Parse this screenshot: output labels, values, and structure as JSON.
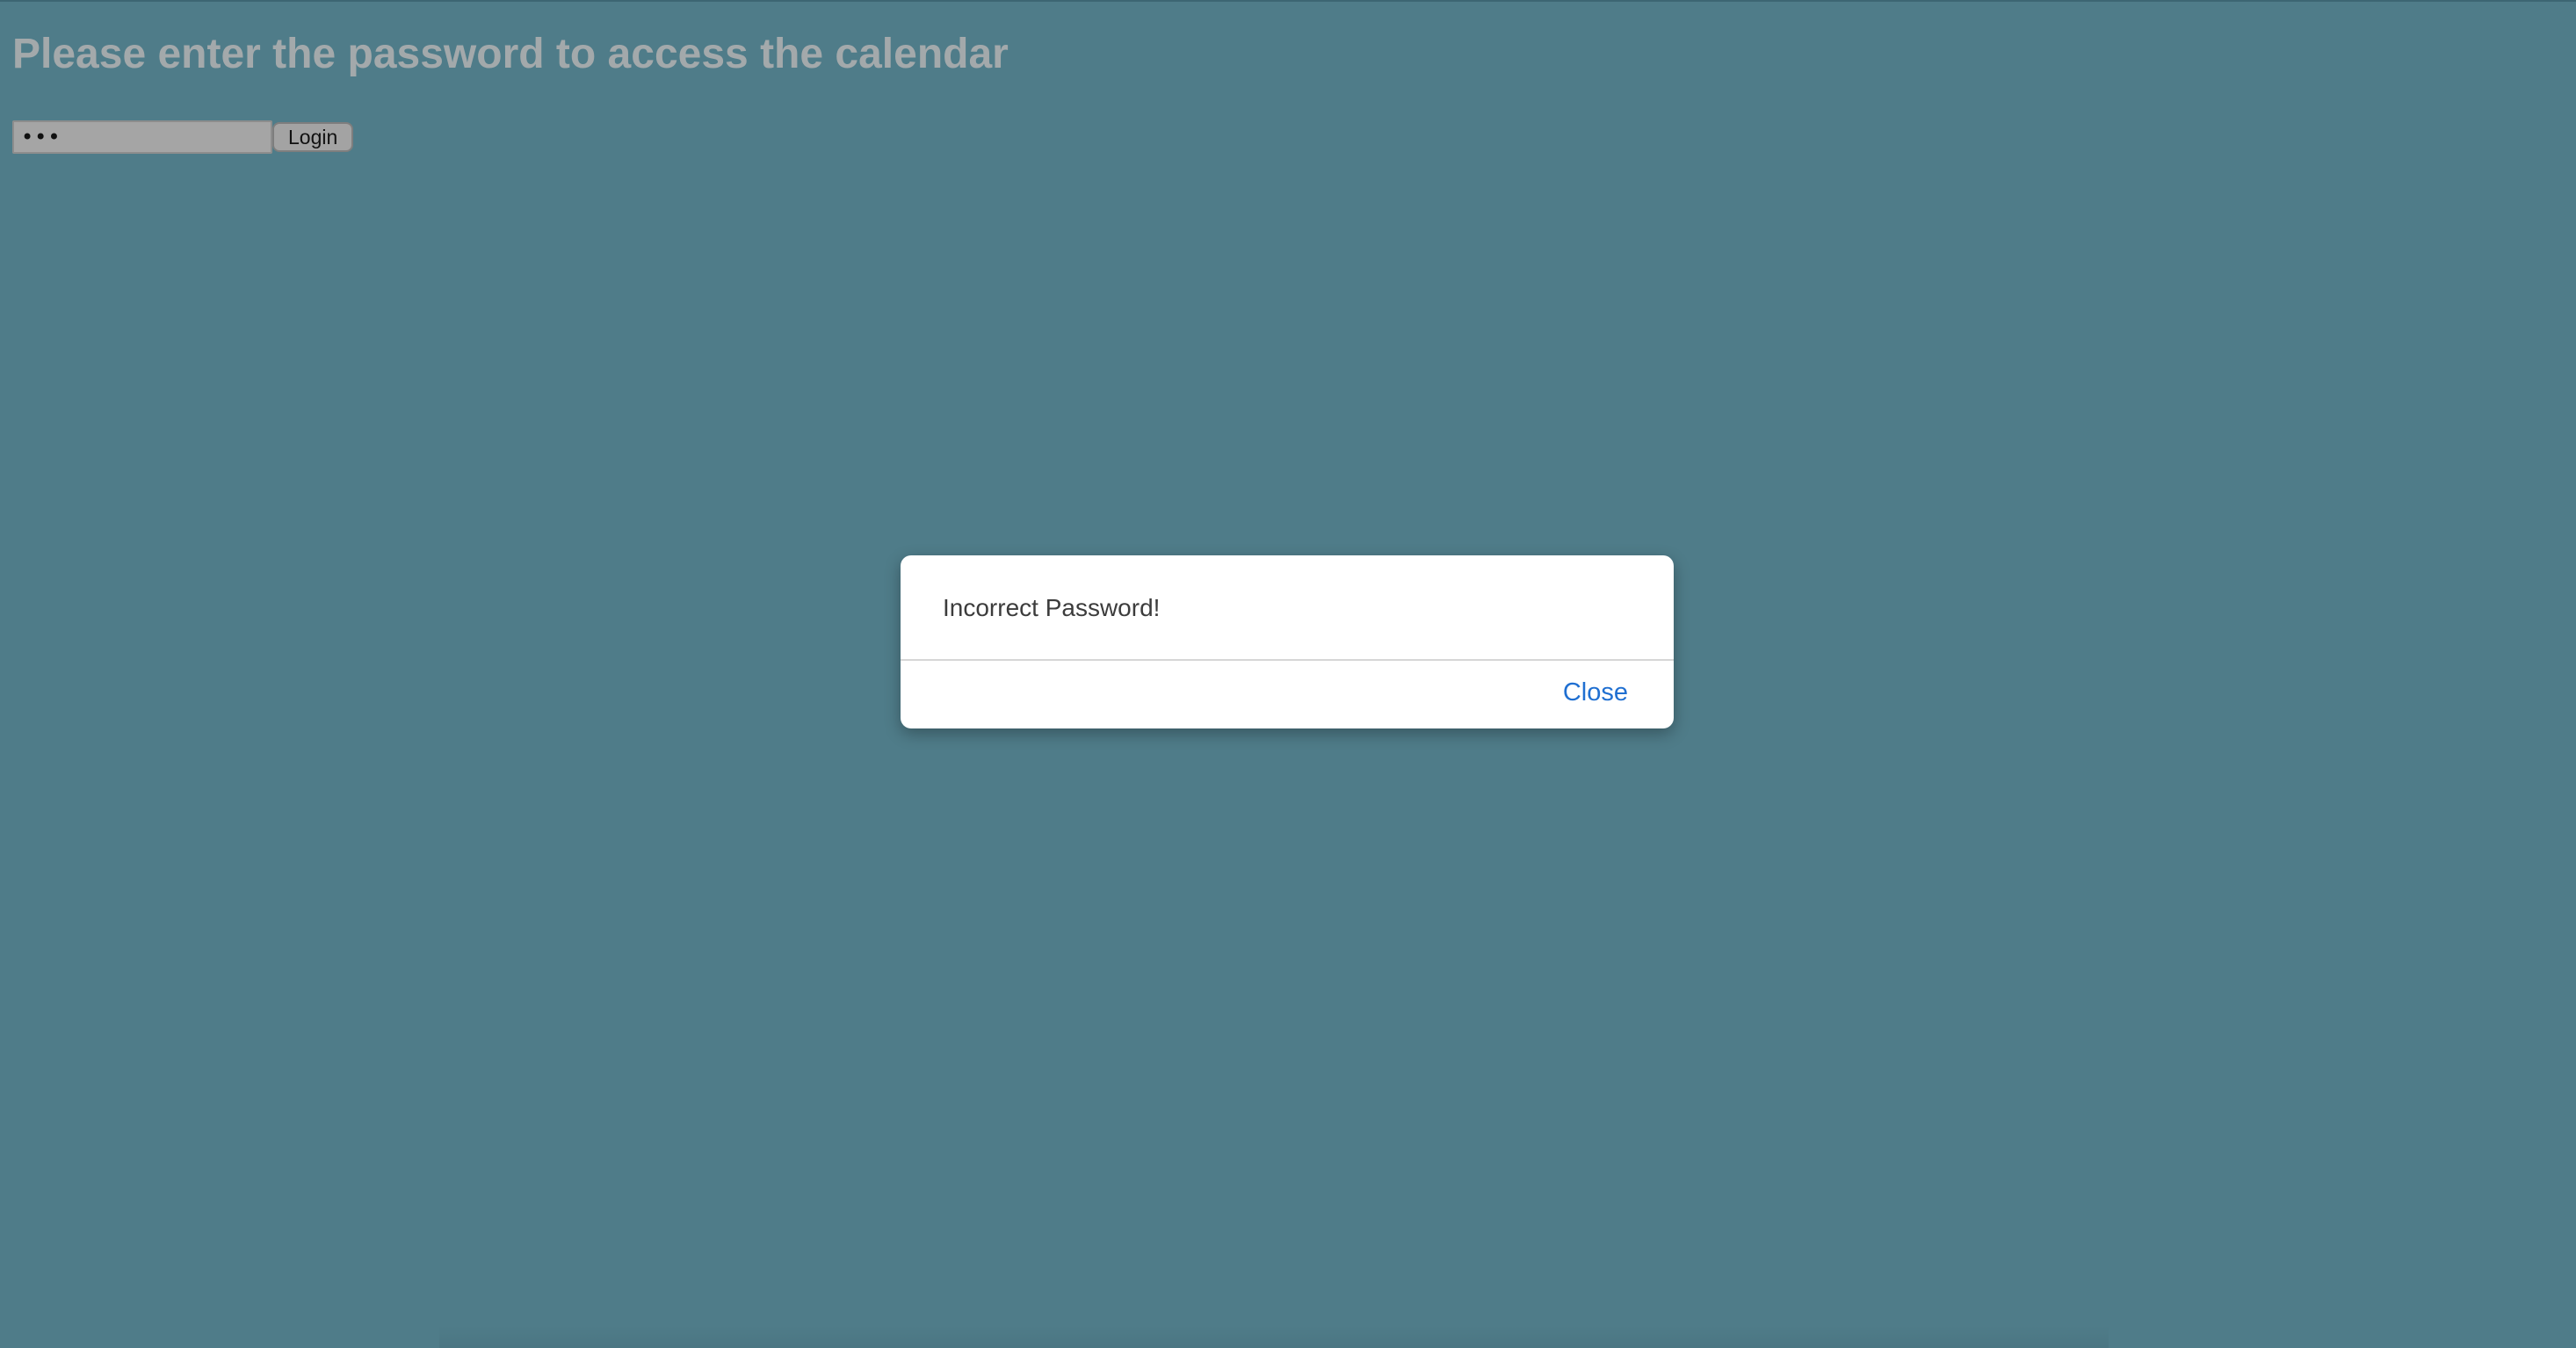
{
  "page": {
    "title": "Please enter the password to access the calendar"
  },
  "login": {
    "password_value": "•••",
    "button_label": "Login"
  },
  "dialog": {
    "message": "Incorrect Password!",
    "close_label": "Close"
  },
  "colors": {
    "background": "#4f7c89",
    "title_text": "#a3a9ab",
    "dialog_background": "#ffffff",
    "link_accent": "#1f6fd1"
  }
}
